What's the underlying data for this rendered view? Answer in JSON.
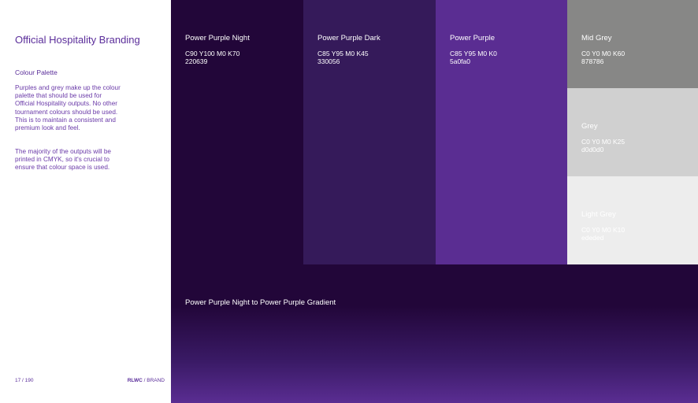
{
  "sidebar": {
    "title": "Official Hospitality Branding",
    "subtitle": "Colour Palette",
    "paragraph1": "Purples and grey make up the colour palette that should be used for Official Hospitality outputs. No other tournament colours should be used. This is to maintain a consistent and premium look and feel.",
    "paragraph2": "The majority of the outputs will be printed in CMYK, so it's crucial to ensure that colour space is used."
  },
  "footer": {
    "page": "17 / 190",
    "brand_bold": "RLWC",
    "brand_rest": " / BRAND"
  },
  "swatches": {
    "night": {
      "name": "Power Purple Night",
      "cmyk": "C90 Y100 M0 K70",
      "hex": "220639",
      "color": "#220639"
    },
    "dark": {
      "name": "Power Purple Dark",
      "cmyk": "C85 Y95 M0 K45",
      "hex": "330056",
      "color": "#351a5a"
    },
    "purple": {
      "name": "Power Purple",
      "cmyk": "C85 Y95 M0 K0",
      "hex": "5a0fa0",
      "color": "#5a2d92"
    },
    "mid": {
      "name": "Mid Grey",
      "cmyk": "C0 Y0 M0 K60",
      "hex": "878786",
      "color": "#878786"
    },
    "grey": {
      "name": "Grey",
      "cmyk": "C0 Y0 M0 K25",
      "hex": "d0d0d0",
      "color": "#d0d0d0"
    },
    "light": {
      "name": "Light Grey",
      "cmyk": "C0 Y0 M0 K10",
      "hex": "ededed",
      "color": "#ededed"
    }
  },
  "gradient": {
    "name": "Power Purple Night to Power Purple Gradient"
  }
}
